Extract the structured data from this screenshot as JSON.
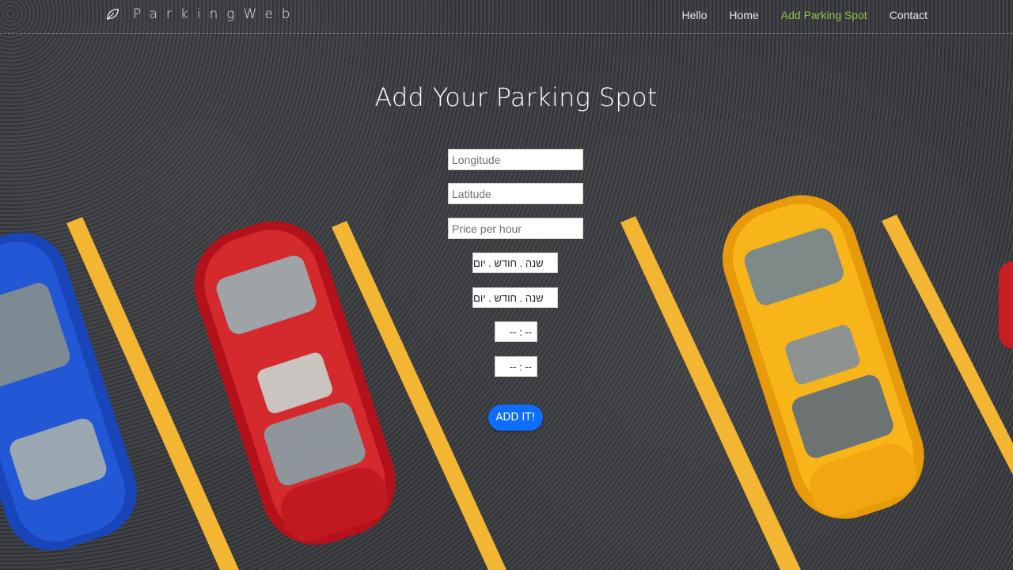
{
  "navbar": {
    "brand": "ParkingWeb",
    "brand_icon": "leaf-icon",
    "items": [
      {
        "label": "Hello",
        "active": false
      },
      {
        "label": "Home",
        "active": false
      },
      {
        "label": "Add Parking Spot",
        "active": true
      },
      {
        "label": "Contact",
        "active": false
      }
    ]
  },
  "page": {
    "title": "Add Your Parking Spot"
  },
  "form": {
    "longitude_placeholder": "Longitude",
    "latitude_placeholder": "Latitude",
    "price_placeholder": "Price per hour",
    "start_date_value": "שנה . חודש . יום",
    "end_date_value": "שנה . חודש . יום",
    "start_time_value": "-- : --",
    "end_time_value": "-- : --",
    "submit_label": "ADD IT!"
  },
  "colors": {
    "accent_active_nav": "#8bc34a",
    "button": "#0d6efd"
  }
}
